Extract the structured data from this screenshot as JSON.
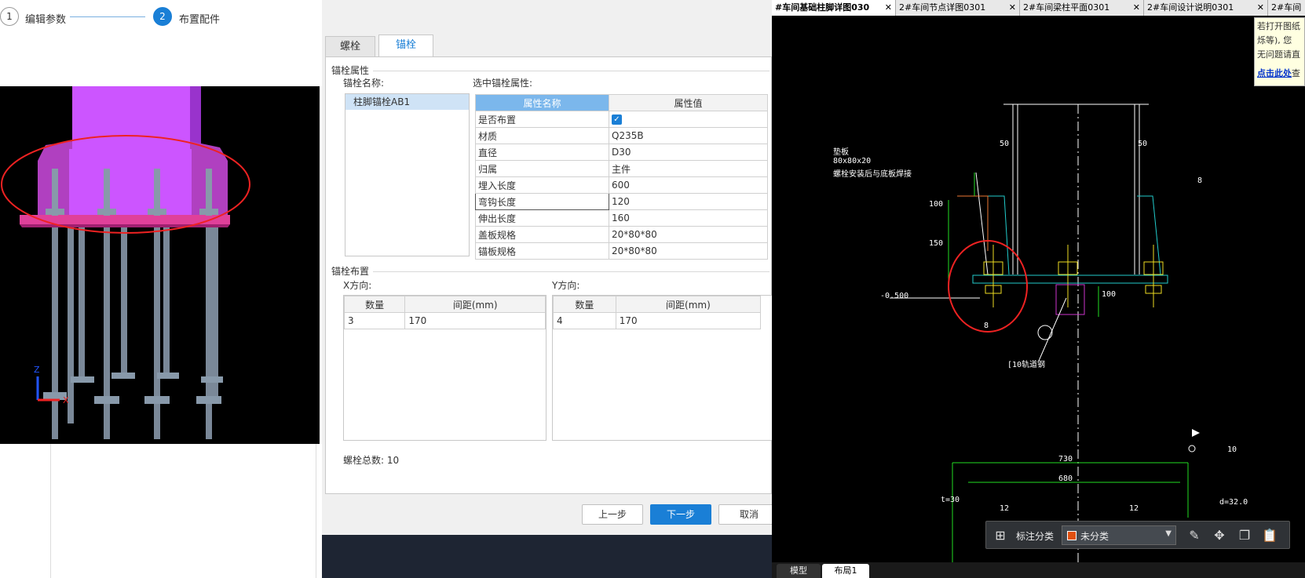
{
  "wizard": {
    "steps": [
      {
        "num": "1",
        "label": "编辑参数"
      },
      {
        "num": "2",
        "label": "布置配件"
      }
    ]
  },
  "tabs": [
    {
      "label": "螺栓"
    },
    {
      "label": "锚栓"
    }
  ],
  "anchor_props": {
    "group_title": "锚栓属性",
    "name_label": "锚栓名称:",
    "selected_label": "选中锚栓属性:",
    "names": [
      "柱脚锚栓AB1"
    ],
    "table_headers": [
      "属性名称",
      "属性值"
    ],
    "rows": [
      {
        "name": "是否布置",
        "value": ""
      },
      {
        "name": "材质",
        "value": "Q235B"
      },
      {
        "name": "直径",
        "value": "D30"
      },
      {
        "name": "归属",
        "value": "主件"
      },
      {
        "name": "埋入长度",
        "value": "600"
      },
      {
        "name": "弯钩长度",
        "value": "120"
      },
      {
        "name": "伸出长度",
        "value": "160"
      },
      {
        "name": "盖板规格",
        "value": "20*80*80"
      },
      {
        "name": "锚板规格",
        "value": "20*80*80"
      }
    ]
  },
  "layout_group": {
    "title": "锚栓布置",
    "x_label": "X方向:",
    "y_label": "Y方向:",
    "headers": [
      "数量",
      "间距(mm)"
    ],
    "x_rows": [
      {
        "count": "3",
        "spacing": "170"
      }
    ],
    "y_rows": [
      {
        "count": "4",
        "spacing": "170"
      }
    ],
    "total": "螺栓总数: 10"
  },
  "buttons": {
    "prev": "上一步",
    "next": "下一步",
    "cancel": "取消"
  },
  "cad": {
    "tabs": [
      {
        "label": "#车间基础柱脚详图030"
      },
      {
        "label": "2#车间节点详图0301"
      },
      {
        "label": "2#车间梁柱平面0301"
      },
      {
        "label": "2#车间设计说明0301"
      },
      {
        "label": "2#车间"
      }
    ],
    "tooltip_lines": [
      "若打开图纸",
      "烁等), 您",
      "无问题请直"
    ],
    "tooltip_link": "点击此处",
    "tooltip_link_suffix": "查",
    "labels": {
      "d50a": "50",
      "d50b": "50",
      "d8": "8",
      "plate": "垫板",
      "plate_spec": "80x80x20",
      "plate_note": "螺栓安装后与底板焊接",
      "d100": "100",
      "d150": "150",
      "elev": "-0.500",
      "d100b": "100",
      "d8b": "8",
      "channel": "[10轨道钢",
      "d730": "730",
      "d680": "680",
      "t30": "t=30",
      "d12a": "12",
      "d12b": "12",
      "d10": "10",
      "d32": "d=32.0"
    },
    "toolbar": {
      "category_label": "标注分类",
      "category_value": "未分类"
    },
    "bottom_tabs": [
      {
        "label": "模型"
      },
      {
        "label": "布局1"
      }
    ]
  },
  "colors": {
    "accent": "#1a7fd6",
    "cad_bg": "#000000",
    "column_magenta": "#cc55ff"
  }
}
